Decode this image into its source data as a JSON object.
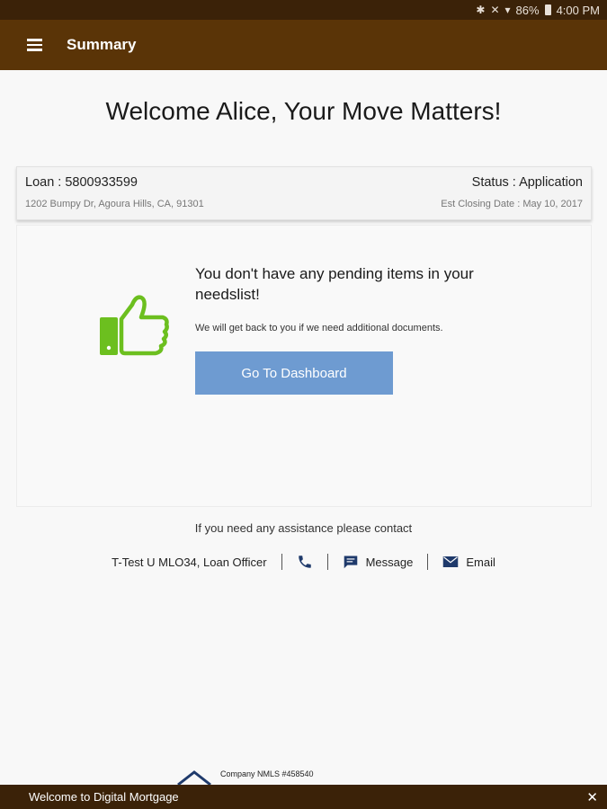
{
  "status_bar": {
    "battery": "86%",
    "time": "4:00 PM"
  },
  "app_bar": {
    "title": "Summary"
  },
  "welcome": "Welcome Alice, Your Move Matters!",
  "loan": {
    "number_label": "Loan : 5800933599",
    "status_label": "Status : Application",
    "address": "1202 Bumpy Dr, Agoura Hills, CA, 91301",
    "closing_label": "Est Closing Date : May 10, 2017"
  },
  "needs": {
    "title": "You don't have any pending items in your needslist!",
    "subtitle": "We will get back to you if we need additional documents.",
    "button_label": "Go To Dashboard"
  },
  "contact": {
    "prompt": "If you need any assistance please contact",
    "officer": "T-Test U MLO34, Loan Officer",
    "message_label": "Message",
    "email_label": "Email"
  },
  "footer": {
    "nmls": "Company NMLS #458540"
  },
  "banner": {
    "text": "Welcome to Digital Mortgage",
    "close": "✕"
  },
  "colors": {
    "app_bar": "#5a3407",
    "status_bar": "#3b2208",
    "button": "#6e9bd1",
    "thumb": "#6cbf1f",
    "contact_icon": "#1f3a6b"
  },
  "icons": [
    "menu-icon",
    "bluetooth-icon",
    "mute-icon",
    "wifi-icon",
    "battery-icon",
    "thumbs-up-icon",
    "phone-icon",
    "message-icon",
    "email-icon",
    "equal-housing-icon",
    "close-icon"
  ]
}
